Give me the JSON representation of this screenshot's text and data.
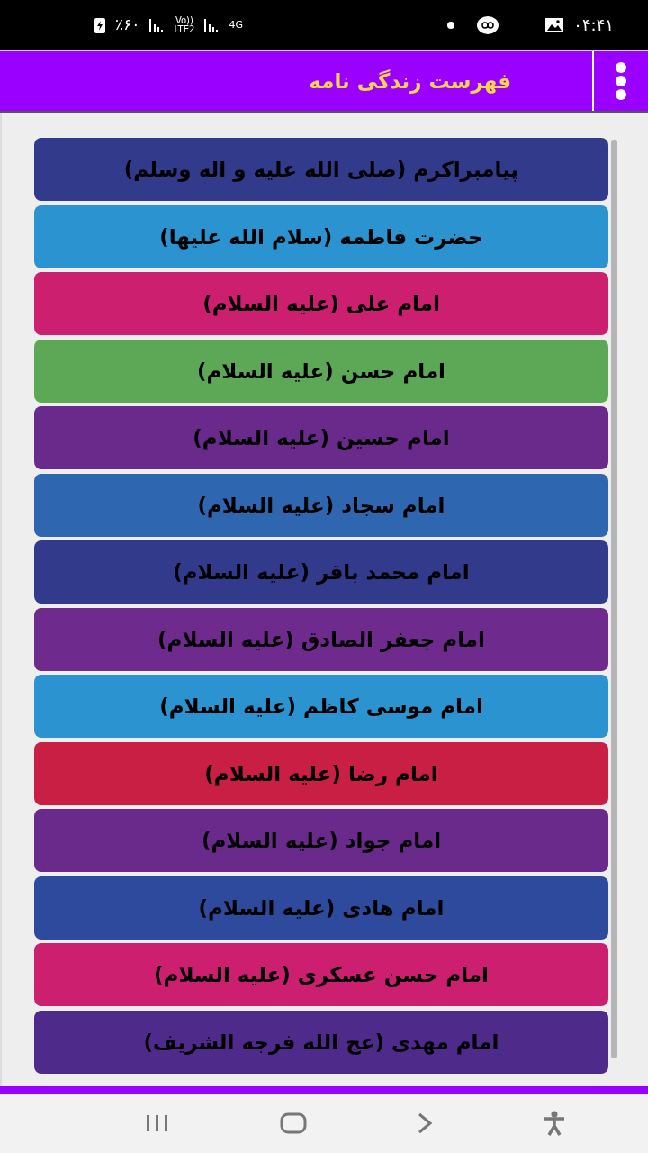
{
  "status_bar": {
    "time": "۰۴:۴۱",
    "battery": "٪۶۰",
    "volte": "Vo))",
    "lte": "LTE2",
    "network": "4G"
  },
  "header": {
    "title": "فهرست زندگی نامه"
  },
  "items": [
    {
      "label": "پیامبراکرم (صلی الله علیه و اله وسلم)",
      "color": "#323a8c"
    },
    {
      "label": "حضرت فاطمه (سلام الله علیها)",
      "color": "#2a93d0"
    },
    {
      "label": "امام علی (علیه السلام)",
      "color": "#cc1f6f"
    },
    {
      "label": "امام حسن (علیه السلام)",
      "color": "#5da857"
    },
    {
      "label": "امام حسین (علیه السلام)",
      "color": "#6a2a8c"
    },
    {
      "label": "امام سجاد (علیه السلام)",
      "color": "#2f66b0"
    },
    {
      "label": "امام محمد باقر (علیه السلام)",
      "color": "#323a8c"
    },
    {
      "label": "امام جعفر الصادق (علیه السلام)",
      "color": "#6e2a8c"
    },
    {
      "label": "امام موسی کاظم (علیه السلام)",
      "color": "#2a93d0"
    },
    {
      "label": "امام رضا (علیه السلام)",
      "color": "#c91f45"
    },
    {
      "label": "امام جواد (علیه السلام)",
      "color": "#6a2a8c"
    },
    {
      "label": "امام هادی (علیه السلام)",
      "color": "#2d4a9c"
    },
    {
      "label": "امام حسن عسکری (علیه السلام)",
      "color": "#cc1f6f"
    },
    {
      "label": "امام مهدی (عج الله فرجه الشریف)",
      "color": "#4e2a8a"
    }
  ]
}
